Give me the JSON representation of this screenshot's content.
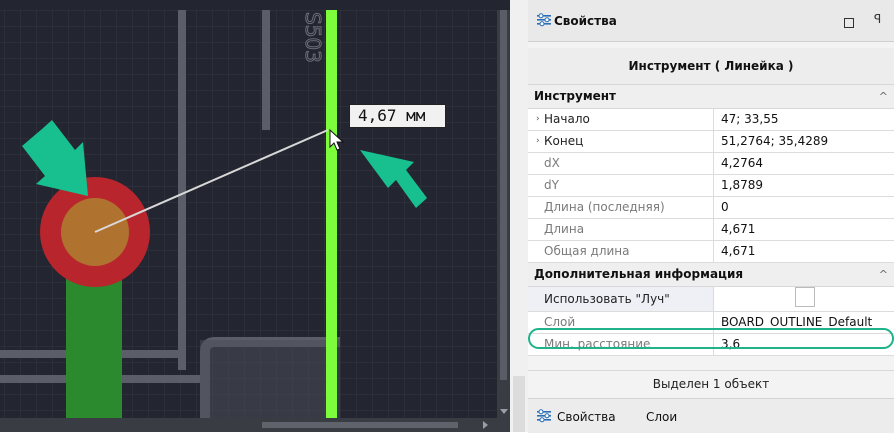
{
  "canvas": {
    "measurement_label": "4,67 мм",
    "reference_designator": "S503"
  },
  "panel": {
    "title": "Свойства",
    "subtitle": "Инструмент ( Линейка )",
    "categories": [
      {
        "label": "Инструмент",
        "rows": [
          {
            "name": "Начало",
            "value": "47; 33,55"
          },
          {
            "name": "Конец",
            "value": "51,2764; 35,4289"
          },
          {
            "name": "dX",
            "value": "4,2764"
          },
          {
            "name": "dY",
            "value": "1,8789"
          },
          {
            "name": "Длина (последняя)",
            "value": "0"
          },
          {
            "name": "Длина",
            "value": "4,671"
          },
          {
            "name": "Общая длина",
            "value": "4,671"
          }
        ]
      },
      {
        "label": "Дополнительная информация",
        "rows": [
          {
            "name": "Использовать \"Луч\"",
            "value": ""
          },
          {
            "name": "Слой",
            "value": "BOARD_OUTLINE_Default"
          },
          {
            "name": "Мин. расстояние",
            "value": "3,6"
          }
        ]
      }
    ],
    "status": "Выделен 1 объект",
    "tabs": [
      "Свойства",
      "Слои"
    ]
  },
  "colors": {
    "canvas_bg": "#232530",
    "board_outline": "#7cfc3a",
    "pad_outer": "#b8252d",
    "pad_inner": "#b0722f",
    "trace": "#2a8a2d",
    "annotation_arrow": "#17c08e",
    "highlight_oval": "#1fb38a"
  }
}
